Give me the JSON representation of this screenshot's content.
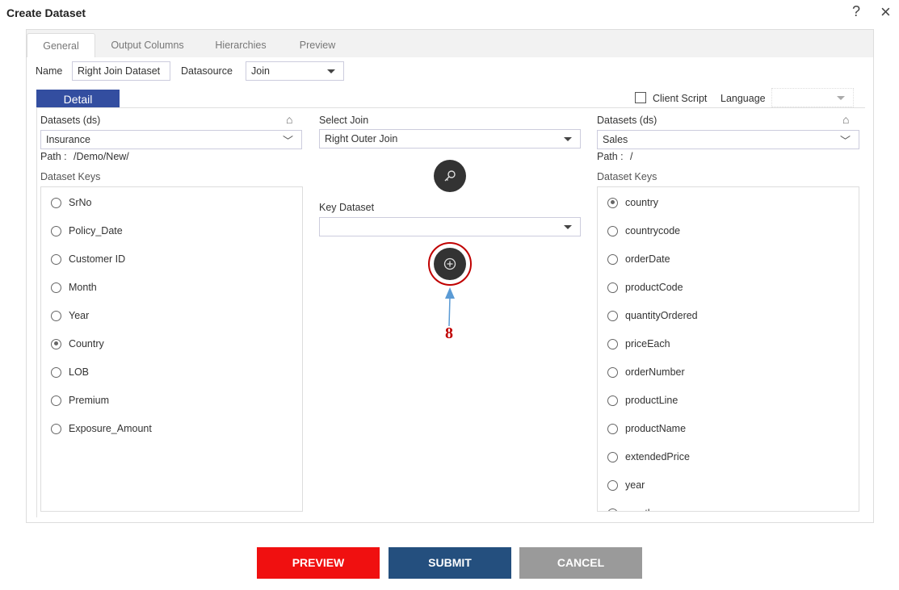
{
  "dialog": {
    "title": "Create Dataset",
    "help_icon": "?",
    "close_icon": "×"
  },
  "tabs": [
    {
      "label": "General",
      "active": true
    },
    {
      "label": "Output Columns"
    },
    {
      "label": "Hierarchies"
    },
    {
      "label": "Preview"
    }
  ],
  "form": {
    "name_label": "Name",
    "name_value": "Right Join Dataset",
    "datasource_label": "Datasource",
    "datasource_value": "Join",
    "client_script_label": "Client Script",
    "client_script_checked": false,
    "language_label": "Language",
    "language_value": ""
  },
  "detail_tab": "Detail",
  "left": {
    "datasets_label": "Datasets (ds)",
    "dataset_value": "Insurance",
    "path_label": "Path :",
    "path_value": "/Demo/New/",
    "keys_label": "Dataset Keys",
    "keys": [
      "SrNo",
      "Policy_Date",
      "Customer ID",
      "Month",
      "Year",
      "Country",
      "LOB",
      "Premium",
      "Exposure_Amount"
    ],
    "selected": "Country"
  },
  "middle": {
    "select_join_label": "Select Join",
    "select_join_value": "Right Outer Join",
    "key_dataset_label": "Key Dataset",
    "key_dataset_value": "",
    "annotation": "8",
    "annotation_color": "#c00000",
    "arrow_color": "#5b9bd5"
  },
  "right": {
    "datasets_label": "Datasets (ds)",
    "dataset_value": "Sales",
    "path_label": "Path :",
    "path_value": "/",
    "keys_label": "Dataset Keys",
    "keys": [
      "country",
      "countrycode",
      "orderDate",
      "productCode",
      "quantityOrdered",
      "priceEach",
      "orderNumber",
      "productLine",
      "productName",
      "extendedPrice",
      "year",
      "month"
    ],
    "selected": "country"
  },
  "buttons": {
    "preview": "PREVIEW",
    "submit": "SUBMIT",
    "cancel": "CANCEL",
    "preview_color": "#f01010",
    "submit_color": "#244f7e",
    "cancel_color": "#9a9a9a"
  }
}
